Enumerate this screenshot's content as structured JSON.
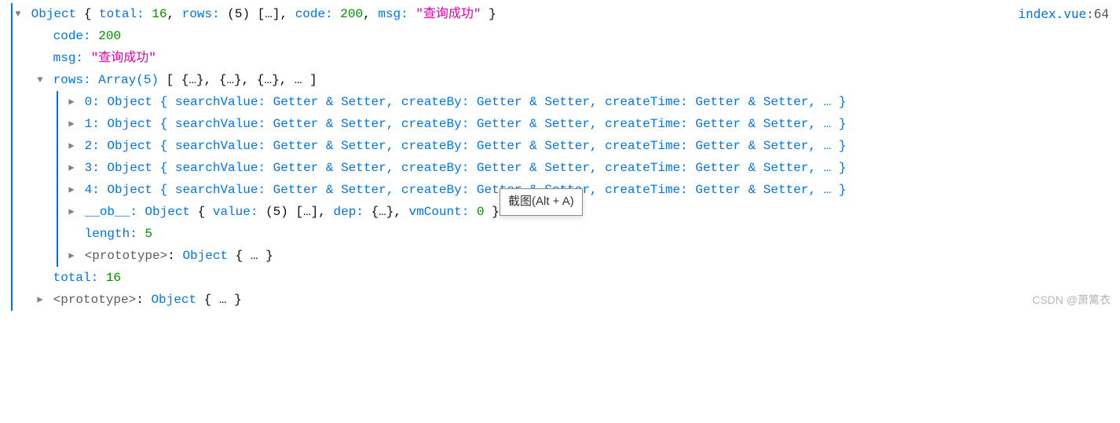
{
  "source": {
    "file": "index.vue",
    "line": "64"
  },
  "watermark": "CSDN @萧篱衣",
  "tooltip": "截图(Alt + A)",
  "disclosure": {
    "open": "▼",
    "closed": "▶"
  },
  "root": {
    "type": "Object",
    "summary": {
      "total_key": "total",
      "total_val": "16",
      "rows_key": "rows",
      "rows_val": "(5) […]",
      "code_key": "code",
      "code_val": "200",
      "msg_key": "msg",
      "msg_val": "\"查询成功\""
    },
    "code": {
      "key": "code",
      "val": "200"
    },
    "msg": {
      "key": "msg",
      "val": "\"查询成功\""
    },
    "rows": {
      "key": "rows",
      "type": "Array(5)",
      "summary": "[ {…}, {…}, {…}, … ]",
      "items": [
        {
          "idx": "0",
          "type": "Object",
          "props": "{ searchValue: Getter & Setter, createBy: Getter & Setter, createTime: Getter & Setter, … }"
        },
        {
          "idx": "1",
          "type": "Object",
          "props": "{ searchValue: Getter & Setter, createBy: Getter & Setter, createTime: Getter & Setter, … }"
        },
        {
          "idx": "2",
          "type": "Object",
          "props": "{ searchValue: Getter & Setter, createBy: Getter & Setter, createTime: Getter & Setter, … }"
        },
        {
          "idx": "3",
          "type": "Object",
          "props": "{ searchValue: Getter & Setter, createBy: Getter & Setter, createTime: Getter & Setter, … }"
        },
        {
          "idx": "4",
          "type": "Object",
          "props": "{ searchValue: Getter & Setter, createBy: Getter & Setter, createTime: Getter & Setter, … }"
        }
      ],
      "ob": {
        "key": "__ob__",
        "type": "Object",
        "summary_value_key": "value",
        "summary_value": "(5) […]",
        "summary_dep_key": "dep",
        "summary_dep": "{…}",
        "summary_vm_key": "vmCount",
        "summary_vm": "0"
      },
      "length": {
        "key": "length",
        "val": "5"
      },
      "proto": {
        "key": "<prototype>",
        "type": "Object",
        "summary": "{ … }"
      }
    },
    "total": {
      "key": "total",
      "val": "16"
    },
    "proto": {
      "key": "<prototype>",
      "type": "Object",
      "summary": "{ … }"
    }
  }
}
